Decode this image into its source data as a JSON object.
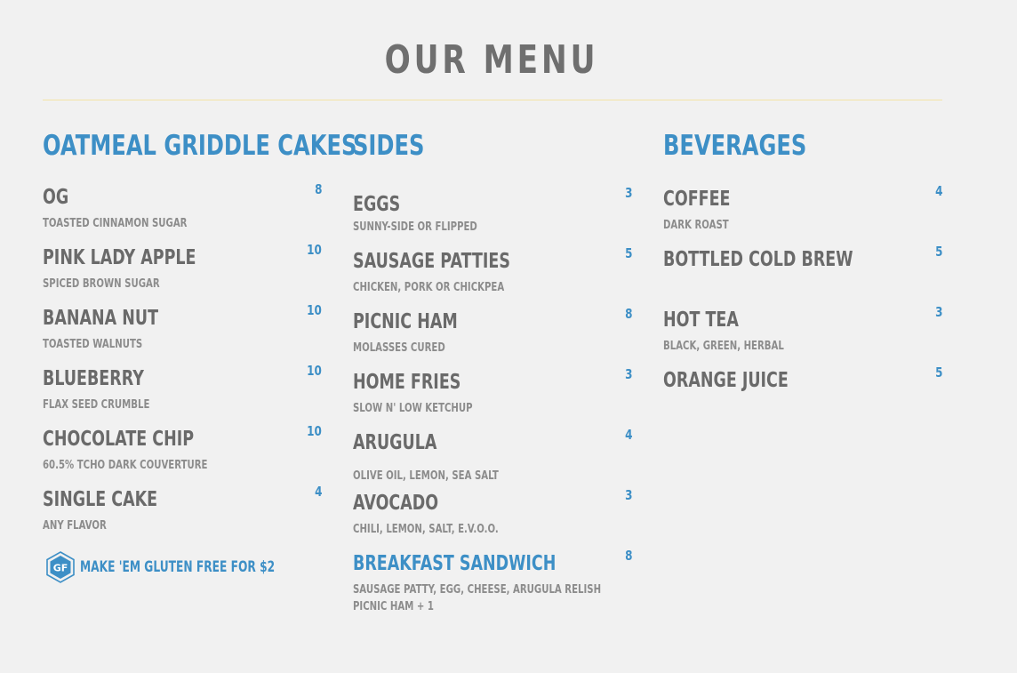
{
  "title": "OUR MENU",
  "colors": {
    "accent": "#3d8fc6",
    "text": "#6a6a6a",
    "muted": "#8c8c8c",
    "rule": "#f3e3a6",
    "background": "#f1f1f1"
  },
  "columns": [
    {
      "heading": "OATMEAL GRIDDLE CAKES",
      "items": [
        {
          "name": "OG",
          "price": "8",
          "desc": [
            "TOASTED CINNAMON SUGAR"
          ]
        },
        {
          "name": "PINK LADY APPLE",
          "price": "10",
          "desc": [
            "SPICED BROWN SUGAR"
          ]
        },
        {
          "name": "BANANA NUT",
          "price": "10",
          "desc": [
            "TOASTED WALNUTS"
          ]
        },
        {
          "name": "BLUEBERRY",
          "price": "10",
          "desc": [
            "FLAX SEED CRUMBLE"
          ]
        },
        {
          "name": "CHOCOLATE CHIP",
          "price": "10",
          "desc": [
            "60.5% TCHO DARK COUVERTURE"
          ]
        },
        {
          "name": "SINGLE CAKE",
          "price": "4",
          "desc": [
            "ANY FLAVOR"
          ]
        }
      ],
      "note": {
        "badge": "GF",
        "badge_icon": "gluten-free-hexagon-icon",
        "text": "MAKE 'EM GLUTEN FREE FOR $2"
      }
    },
    {
      "heading": "SIDES",
      "items": [
        {
          "name": "EGGS",
          "price": "3",
          "desc": [
            "SUNNY-SIDE OR FLIPPED"
          ]
        },
        {
          "name": "SAUSAGE PATTIES",
          "price": "5",
          "desc": [
            "CHICKEN, PORK OR CHICKPEA"
          ]
        },
        {
          "name": "PICNIC HAM",
          "price": "8",
          "desc": [
            "MOLASSES CURED"
          ]
        },
        {
          "name": "HOME FRIES",
          "price": "3",
          "desc": [
            "SLOW N' LOW KETCHUP"
          ]
        },
        {
          "name": "ARUGULA",
          "price": "4",
          "desc": [
            "OLIVE OIL, LEMON, SEA SALT"
          ]
        },
        {
          "name": "AVOCADO",
          "price": "3",
          "desc": [
            "CHILI, LEMON, SALT, E.V.O.O."
          ]
        },
        {
          "name": "BREAKFAST SANDWICH",
          "price": "8",
          "accent": true,
          "desc": [
            "SAUSAGE PATTY, EGG, CHEESE, ARUGULA RELISH",
            "PICNIC HAM + 1"
          ]
        }
      ]
    },
    {
      "heading": "BEVERAGES",
      "items": [
        {
          "name": "COFFEE",
          "price": "4",
          "desc": [
            "DARK ROAST"
          ]
        },
        {
          "name": "BOTTLED COLD BREW",
          "price": "5",
          "desc": []
        },
        {
          "name": "HOT TEA",
          "price": "3",
          "desc": [
            "BLACK, GREEN, HERBAL"
          ]
        },
        {
          "name": "ORANGE JUICE",
          "price": "5",
          "desc": []
        }
      ]
    }
  ]
}
